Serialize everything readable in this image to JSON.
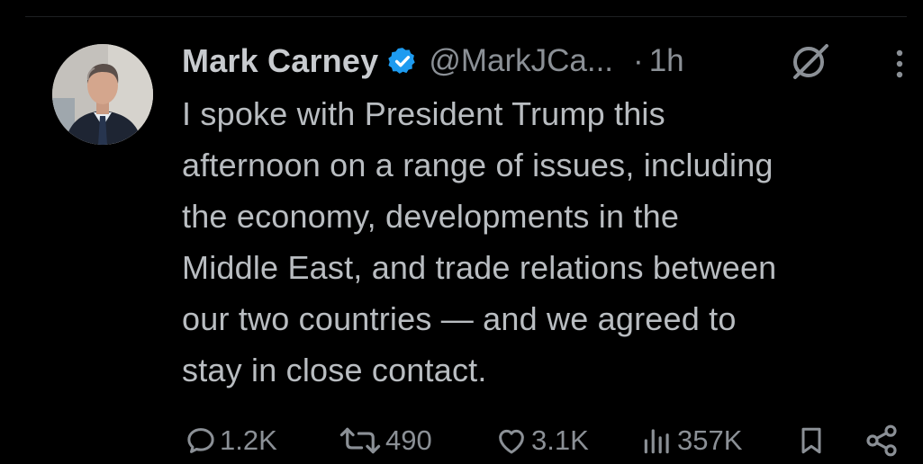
{
  "tweet": {
    "author": {
      "display_name": "Mark Carney",
      "handle": "@MarkJCa...",
      "verified": true,
      "avatar_icon": "profile-photo"
    },
    "separator": "·",
    "time": "1h",
    "text": "I spoke with President Trump this\nafternoon on a range of issues, including\nthe economy, developments in the\nMiddle East, and trade relations between\nour two countries — and we agreed to\nstay in close contact.",
    "stats": {
      "replies": "1.2K",
      "reposts": "490",
      "likes": "3.1K",
      "views": "357K"
    }
  },
  "colors": {
    "background": "#000000",
    "text": "#b9bdc1",
    "secondary": "#8b9096",
    "verified_badge": "#1d9bf0"
  },
  "icons": {
    "header": [
      "verified-badge-icon",
      "grok-icon",
      "more-options-icon"
    ],
    "actions": [
      "reply-icon",
      "repost-icon",
      "like-icon",
      "views-icon",
      "bookmark-icon",
      "share-icon"
    ]
  }
}
